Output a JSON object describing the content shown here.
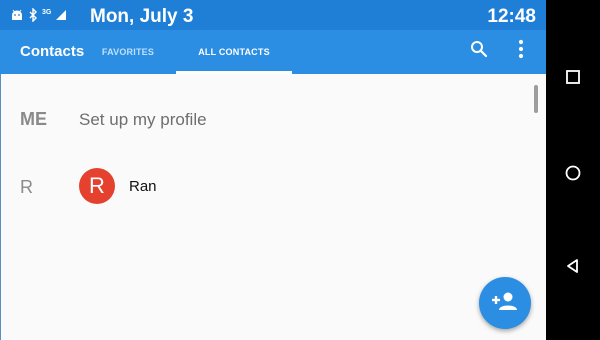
{
  "status_bar": {
    "date": "Mon, July 3",
    "time": "12:48",
    "network_label": "3G",
    "icons": [
      "android-icon",
      "bluetooth-icon",
      "signal-icon"
    ]
  },
  "app_bar": {
    "title": "Contacts",
    "tabs": [
      {
        "label": "FAVORITES",
        "selected": false
      },
      {
        "label": "ALL CONTACTS",
        "selected": true
      }
    ],
    "actions": [
      "search-icon",
      "more-vert-icon"
    ]
  },
  "list": {
    "me_section": {
      "header": "ME",
      "text": "Set up my profile"
    },
    "sections": [
      {
        "header": "R",
        "contacts": [
          {
            "initial": "R",
            "name": "Ran",
            "avatar_color": "#e5412f"
          }
        ]
      }
    ]
  },
  "fab": {
    "icon": "add-contact-icon"
  },
  "nav_bar": {
    "buttons": [
      "recents-icon",
      "home-icon",
      "back-icon"
    ]
  },
  "colors": {
    "primary": "#2b8ee3",
    "status_bar": "#1f7fd6",
    "accent": "#e5412f"
  }
}
